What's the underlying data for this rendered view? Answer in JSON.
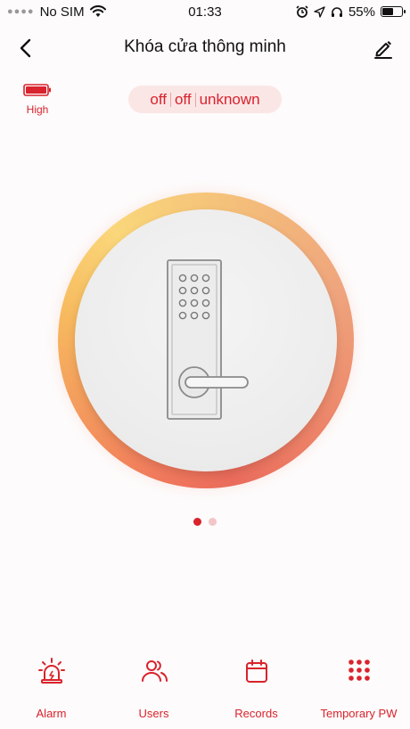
{
  "status_bar": {
    "carrier": "No SIM",
    "time": "01:33",
    "battery_percent": "55%",
    "battery_fraction": 0.55,
    "icons": [
      "signal-dots",
      "wifi-icon",
      "alarm-clock-icon",
      "location-arrow-icon",
      "headphones-icon",
      "battery-icon"
    ]
  },
  "nav": {
    "title": "Khóa cửa thông minh",
    "back_icon": "chevron-left-icon",
    "edit_icon": "pencil-icon"
  },
  "lock_battery": {
    "label": "High",
    "icon": "battery-full-icon",
    "color": "#d9232d"
  },
  "lock_status": {
    "values": [
      "off",
      "off",
      "unknown"
    ]
  },
  "dial": {
    "image": "smart-door-lock-icon",
    "pages": 2,
    "active_page": 0
  },
  "tabs": [
    {
      "label": "Alarm",
      "icon": "alarm-siren-icon"
    },
    {
      "label": "Users",
      "icon": "users-icon"
    },
    {
      "label": "Records",
      "icon": "calendar-icon"
    },
    {
      "label": "Temporary PW",
      "icon": "keypad-icon"
    }
  ],
  "colors": {
    "accent": "#d9232d",
    "pill_bg": "#fbe6e6",
    "ring_warm": "#f7b95e",
    "ring_hot": "#ea6b5b"
  }
}
